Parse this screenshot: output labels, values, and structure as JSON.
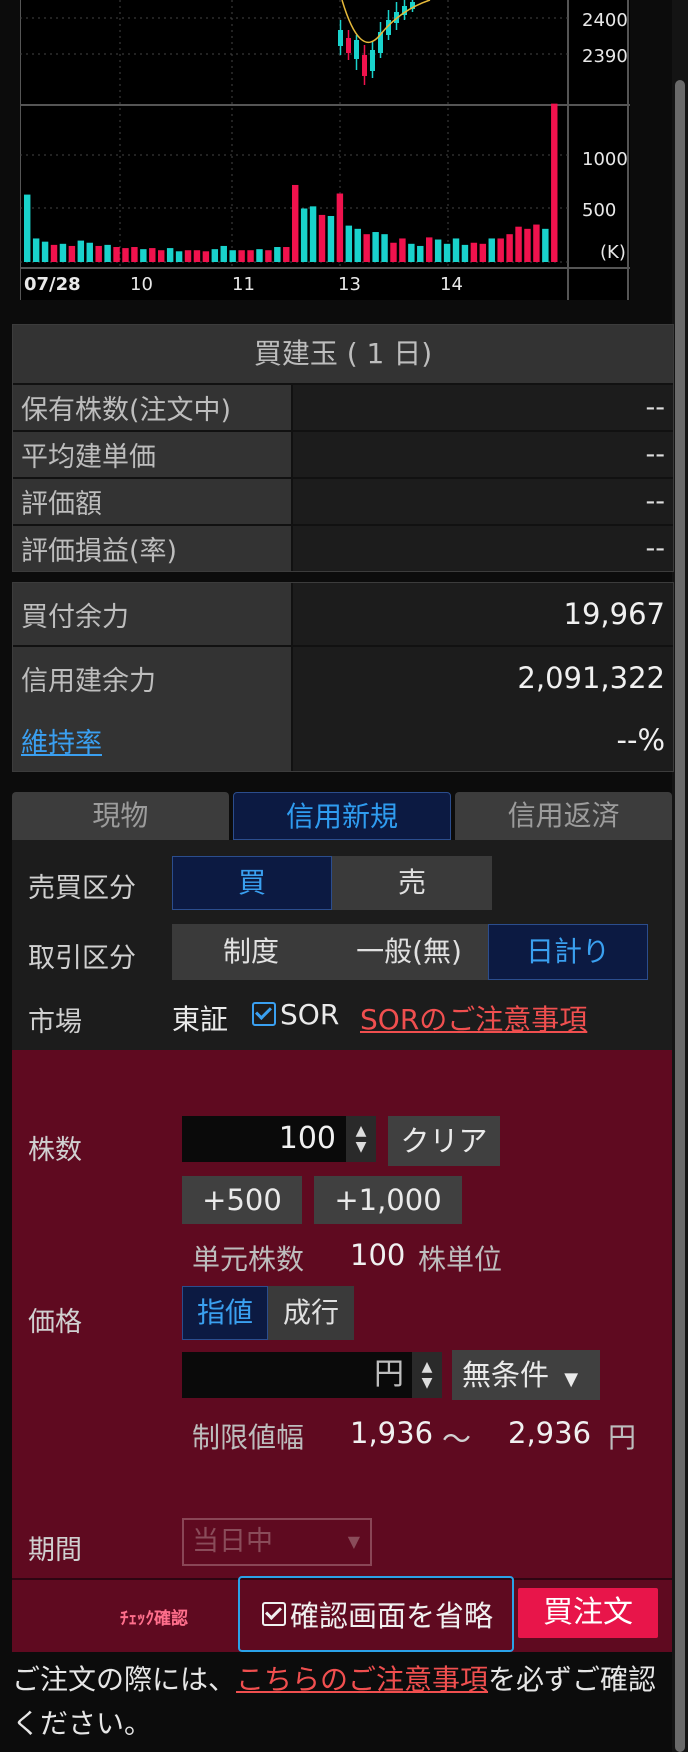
{
  "chart": {
    "price_ticks": [
      "2400",
      "2390"
    ],
    "volume_ticks": [
      "1000",
      "500"
    ],
    "volume_unit": "(K)",
    "date_labels": [
      "07/28",
      "10",
      "11",
      "13",
      "14"
    ],
    "up_color": "#19d3cc",
    "down_color": "#f0124d",
    "volume_bars": [
      {
        "v": 630,
        "c": "up"
      },
      {
        "v": 220,
        "c": "up"
      },
      {
        "v": 190,
        "c": "up"
      },
      {
        "v": 160,
        "c": "down"
      },
      {
        "v": 170,
        "c": "up"
      },
      {
        "v": 150,
        "c": "down"
      },
      {
        "v": 200,
        "c": "up"
      },
      {
        "v": 180,
        "c": "up"
      },
      {
        "v": 150,
        "c": "down"
      },
      {
        "v": 160,
        "c": "up"
      },
      {
        "v": 140,
        "c": "down"
      },
      {
        "v": 130,
        "c": "down"
      },
      {
        "v": 140,
        "c": "down"
      },
      {
        "v": 120,
        "c": "up"
      },
      {
        "v": 130,
        "c": "down"
      },
      {
        "v": 110,
        "c": "down"
      },
      {
        "v": 130,
        "c": "up"
      },
      {
        "v": 100,
        "c": "up"
      },
      {
        "v": 110,
        "c": "down"
      },
      {
        "v": 110,
        "c": "down"
      },
      {
        "v": 100,
        "c": "down"
      },
      {
        "v": 120,
        "c": "up"
      },
      {
        "v": 150,
        "c": "up"
      },
      {
        "v": 110,
        "c": "up"
      },
      {
        "v": 110,
        "c": "down"
      },
      {
        "v": 110,
        "c": "down"
      },
      {
        "v": 120,
        "c": "up"
      },
      {
        "v": 110,
        "c": "down"
      },
      {
        "v": 140,
        "c": "up"
      },
      {
        "v": 140,
        "c": "down"
      },
      {
        "v": 720,
        "c": "down"
      },
      {
        "v": 500,
        "c": "up"
      },
      {
        "v": 520,
        "c": "up"
      },
      {
        "v": 440,
        "c": "down"
      },
      {
        "v": 430,
        "c": "up"
      },
      {
        "v": 640,
        "c": "down"
      },
      {
        "v": 340,
        "c": "up"
      },
      {
        "v": 310,
        "c": "up"
      },
      {
        "v": 260,
        "c": "down"
      },
      {
        "v": 280,
        "c": "up"
      },
      {
        "v": 260,
        "c": "up"
      },
      {
        "v": 180,
        "c": "down"
      },
      {
        "v": 220,
        "c": "down"
      },
      {
        "v": 170,
        "c": "up"
      },
      {
        "v": 150,
        "c": "up"
      },
      {
        "v": 230,
        "c": "down"
      },
      {
        "v": 210,
        "c": "up"
      },
      {
        "v": 170,
        "c": "up"
      },
      {
        "v": 220,
        "c": "up"
      },
      {
        "v": 160,
        "c": "up"
      },
      {
        "v": 180,
        "c": "down"
      },
      {
        "v": 170,
        "c": "down"
      },
      {
        "v": 220,
        "c": "up"
      },
      {
        "v": 220,
        "c": "down"
      },
      {
        "v": 260,
        "c": "down"
      },
      {
        "v": 330,
        "c": "down"
      },
      {
        "v": 310,
        "c": "down"
      },
      {
        "v": 350,
        "c": "down"
      },
      {
        "v": 310,
        "c": "up"
      },
      {
        "v": 1480,
        "c": "down"
      }
    ]
  },
  "position": {
    "title": "買建玉 ( 1 日)",
    "rows": [
      {
        "label": "保有株数(注文中)",
        "value": "--"
      },
      {
        "label": "平均建単価",
        "value": "--"
      },
      {
        "label": "評価額",
        "value": "--"
      },
      {
        "label": "評価損益(率)",
        "value": "--"
      }
    ]
  },
  "funds": {
    "rows": [
      {
        "label": "買付余力",
        "value": "19,967"
      },
      {
        "label": "信用建余力",
        "value": "2,091,322"
      }
    ],
    "maintenance_label": "維持率",
    "maintenance_value": "--%"
  },
  "tabs": [
    "現物",
    "信用新規",
    "信用返済"
  ],
  "order": {
    "side_label": "売買区分",
    "side_options": [
      "買",
      "売"
    ],
    "trade_type_label": "取引区分",
    "trade_type_options": [
      "制度",
      "一般(無)",
      "日計り"
    ],
    "market_label": "市場",
    "market_value": "東証",
    "sor_label": "SOR",
    "sor_link": "SORのご注意事項",
    "qty_label": "株数",
    "qty_value": "100",
    "clear_label": "クリア",
    "plus500": "+500",
    "plus1000": "+1,000",
    "unit_label": "単元株数",
    "unit_value": "100",
    "unit_suffix": "株単位",
    "price_label": "価格",
    "price_type_options": [
      "指値",
      "成行"
    ],
    "price_value": "",
    "price_unit": "円",
    "condition_value": "無条件",
    "limit_label": "制限値幅",
    "limit_low": "1,936",
    "limit_tilde": "～",
    "limit_high": "2,936",
    "limit_unit": "円",
    "period_label": "期間",
    "period_value": "当日中",
    "note_label": "ﾁｪｯｸ確認",
    "omit_confirm_label": "確認画面を省略",
    "submit_label": "買注文"
  },
  "footer": {
    "text_before": "ご注文の際には、",
    "link": "こちらのご注意事項",
    "text_after": "を必ずご確認ください。"
  }
}
